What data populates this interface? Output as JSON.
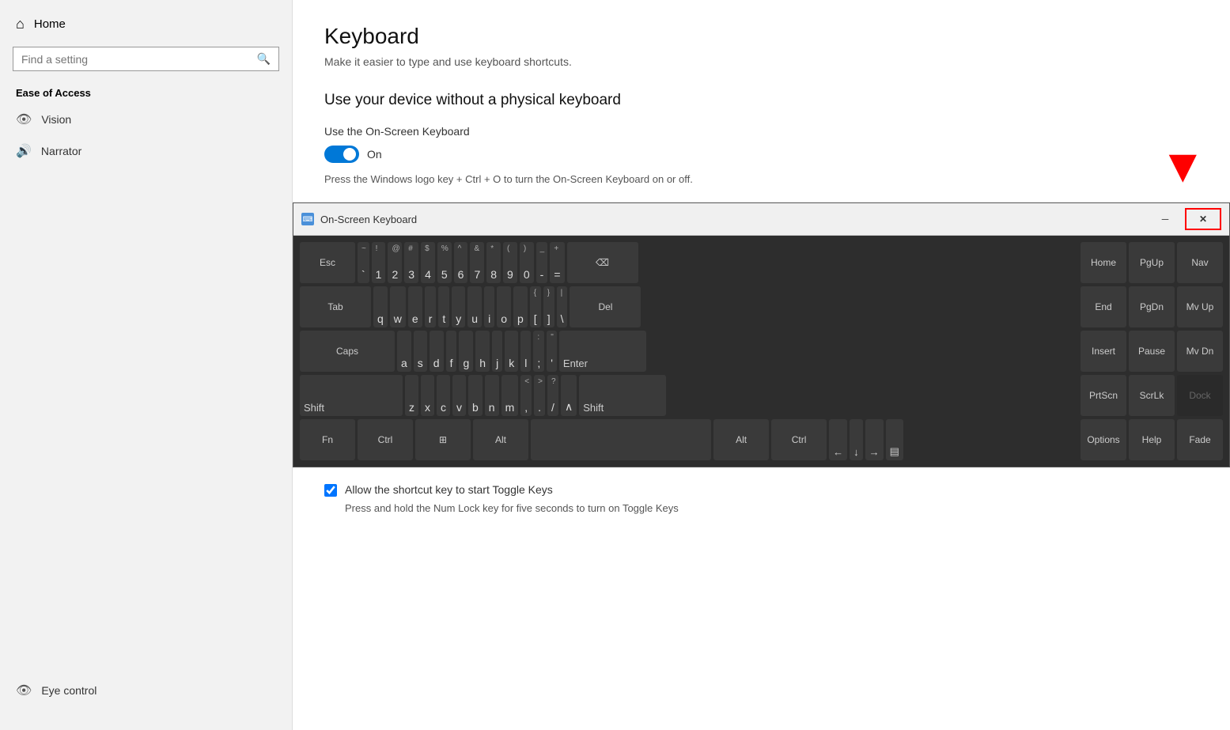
{
  "sidebar": {
    "home_label": "Home",
    "search_placeholder": "Find a setting",
    "section_title": "Ease of Access",
    "items": [
      {
        "label": "Vision",
        "icon": "eye"
      },
      {
        "label": "Narrator",
        "icon": "speaker"
      },
      {
        "label": "Eye control",
        "icon": "eye2"
      }
    ]
  },
  "main": {
    "title": "Keyboard",
    "subtitle": "Make it easier to type and use keyboard shortcuts.",
    "section1": "Use your device without a physical keyboard",
    "osk_setting_label": "Use the On-Screen Keyboard",
    "toggle_state": "On",
    "hint": "Press the Windows logo key  + Ctrl + O to turn the On-Screen Keyboard on or off.",
    "osk_window_title": "On-Screen Keyboard",
    "checkbox_label": "Allow the shortcut key to start Toggle Keys",
    "checkbox_hint": "Press and hold the Num Lock key for five seconds to turn on Toggle Keys"
  },
  "keyboard": {
    "rows": [
      [
        "Esc",
        "~`",
        "!1",
        "@2",
        "#3",
        "$4",
        "%5",
        "^6",
        "&7",
        "*8",
        "(9",
        ")0",
        "-",
        "=",
        "⌫",
        "",
        "Home",
        "PgUp",
        "Nav"
      ],
      [
        "Tab",
        "q",
        "w",
        "e",
        "r",
        "t",
        "y",
        "u",
        "i",
        "o",
        "p",
        "[",
        "]",
        "\\",
        "Del",
        "End",
        "PgDn",
        "Mv Up"
      ],
      [
        "Caps",
        "a",
        "s",
        "d",
        "f",
        "g",
        "h",
        "j",
        "k",
        "l",
        ";",
        "'",
        "Enter",
        "",
        "Insert",
        "Pause",
        "Mv Dn"
      ],
      [
        "Shift",
        "z",
        "x",
        "c",
        "v",
        "b",
        "n",
        "m",
        ",<",
        ">.",
        "?/",
        "^",
        "Shift",
        "",
        "PrtScn",
        "ScrLk",
        "Dock"
      ],
      [
        "Fn",
        "Ctrl",
        "⊞",
        "Alt",
        "",
        "Alt",
        "Ctrl",
        "←",
        "↓",
        "→",
        "",
        "Options",
        "Help",
        "Fade"
      ]
    ]
  }
}
